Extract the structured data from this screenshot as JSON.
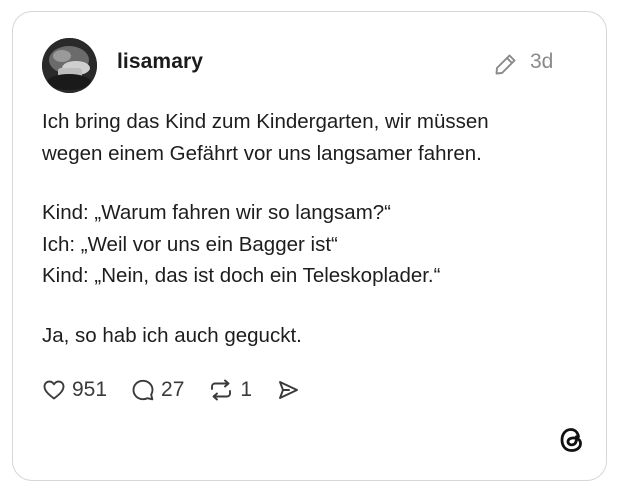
{
  "post": {
    "username": "lisamary",
    "time_ago": "3d",
    "text": {
      "line1": "Ich bring das Kind zum Kindergarten, wir müssen",
      "line2": "wegen einem Gefährt vor uns langsamer fahren.",
      "line3": "Kind: „Warum fahren wir so langsam?“",
      "line4": "Ich: „Weil vor uns ein Bagger ist“",
      "line5": "Kind: „Nein, das ist doch ein Teleskoplader.“",
      "line6": "Ja, so hab ich auch geguckt."
    }
  },
  "actions": {
    "likes": "951",
    "replies": "27",
    "reposts": "1"
  },
  "icons": {
    "edit": "pencil-icon",
    "like": "heart-icon",
    "reply": "speech-bubble-icon",
    "repost": "repost-icon",
    "share": "send-icon",
    "brand": "threads-logo-icon"
  },
  "colors": {
    "border": "#d6d6d6",
    "text": "#1d1d1d",
    "muted": "#8a8a8a"
  }
}
